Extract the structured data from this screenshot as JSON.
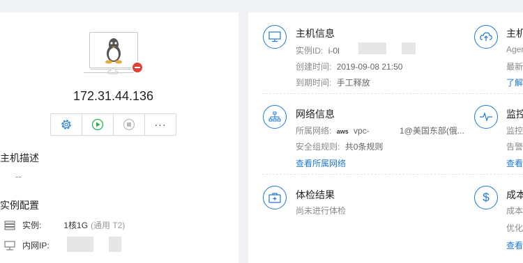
{
  "instance": {
    "ip": "172.31.44.136",
    "actions": [
      "settings-icon",
      "play-icon",
      "stop-icon",
      "more-icon"
    ],
    "more_label": "···",
    "description_title": "主机描述",
    "description_value": "--",
    "config_title": "实例配置",
    "spec_label": "实例:",
    "spec_value": "1核1G",
    "spec_sub": "(通用 T2)",
    "private_ip_label": "内网IP:"
  },
  "host_info": {
    "title": "主机信息",
    "instance_id_label": "实例ID:",
    "instance_id_value": "i-0l",
    "created_label": "创建时间:",
    "created_value": "2019-09-08 21:50",
    "expire_label": "到期时间:",
    "expire_value": "手工释放"
  },
  "agent_info": {
    "title": "主机",
    "line1": "Agen",
    "line2": "最新",
    "link": "了解"
  },
  "network_info": {
    "title": "网络信息",
    "network_label": "所属网络:",
    "aws_mark": "aws",
    "network_value": "vpc-",
    "network_region": "1@美国东部(俄...",
    "sg_label": "安全组规则:",
    "sg_value": "共0条规则",
    "link": "查看所属网络"
  },
  "monitor_info": {
    "title": "监控",
    "line1": "监控",
    "line2": "告警",
    "link": "查看"
  },
  "health_check": {
    "title": "体检结果",
    "status": "尚未进行体检"
  },
  "cost_info": {
    "title": "成本",
    "line1": "成本",
    "line2": "优化",
    "link": "查看"
  },
  "colors": {
    "accent": "#1e78d6",
    "danger": "#e0413b",
    "run": "#2bb24c"
  }
}
